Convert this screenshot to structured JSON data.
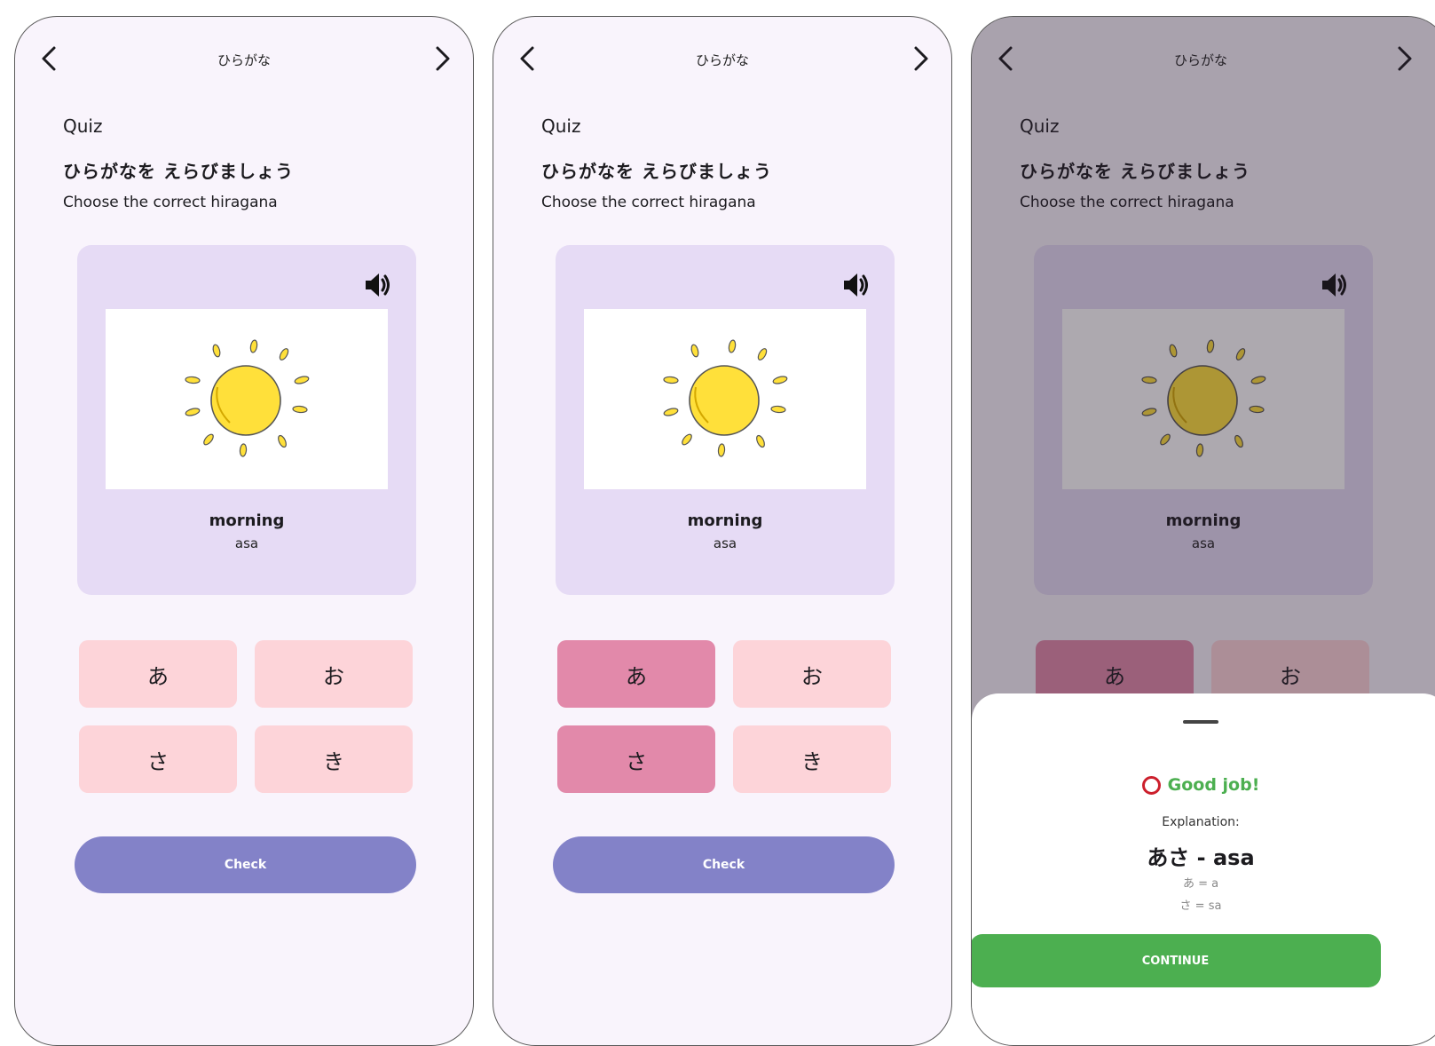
{
  "screens": [
    {
      "title": "ひらがな",
      "section_label": "Quiz",
      "instruction_jp": "ひらがなを えらびましょう",
      "instruction_en": "Choose the correct hiragana",
      "word_en": "morning",
      "word_romaji": "asa",
      "options": [
        "あ",
        "お",
        "さ",
        "き"
      ],
      "selected": [],
      "check_label": "Check"
    },
    {
      "title": "ひらがな",
      "section_label": "Quiz",
      "instruction_jp": "ひらがなを えらびましょう",
      "instruction_en": "Choose the correct hiragana",
      "word_en": "morning",
      "word_romaji": "asa",
      "options": [
        "あ",
        "お",
        "さ",
        "き"
      ],
      "selected": [
        "あ",
        "さ"
      ],
      "check_label": "Check"
    },
    {
      "title": "ひらがな",
      "section_label": "Quiz",
      "instruction_jp": "ひらがなを えらびましょう",
      "instruction_en": "Choose the correct hiragana",
      "word_en": "morning",
      "word_romaji": "asa",
      "options": [
        "あ",
        "お"
      ],
      "selected": [
        "あ"
      ],
      "result": {
        "status": "Good job!",
        "explanation_label": "Explanation:",
        "explanation_main": "あさ - asa",
        "explanation_lines": [
          "あ = a",
          "さ = sa"
        ],
        "continue_label": "CONTINUE"
      }
    }
  ],
  "colors": {
    "screen_bg": "#f9f4fc",
    "card_bg": "#e6dbf5",
    "option_bg": "#fdd4d9",
    "option_selected_bg": "#e289aa",
    "check_button": "#8382c8",
    "success_green": "#4caf50",
    "correct_circle": "#cc1f2c",
    "sun_yellow": "#ffe03a"
  },
  "icons": {
    "back": "chevron-left-icon",
    "next": "chevron-right-icon",
    "speaker": "speaker-icon",
    "image": "sun-illustration",
    "result": "circle-correct-icon"
  }
}
